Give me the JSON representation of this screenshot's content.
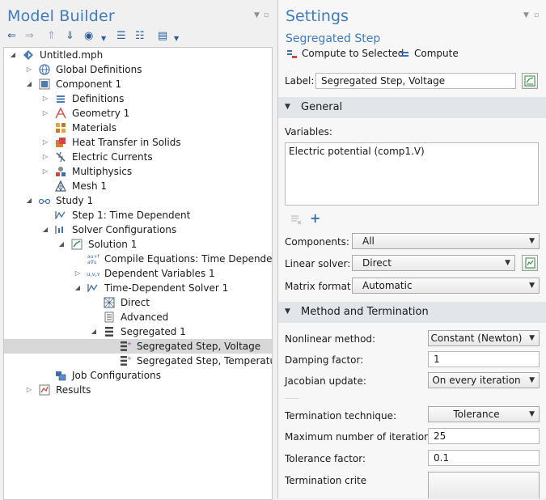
{
  "model_builder": {
    "title": "Model Builder",
    "tree": [
      {
        "label": "Untitled.mph"
      },
      {
        "label": "Global Definitions"
      },
      {
        "label": "Component 1"
      },
      {
        "label": "Definitions"
      },
      {
        "label": "Geometry 1"
      },
      {
        "label": "Materials"
      },
      {
        "label": "Heat Transfer in Solids"
      },
      {
        "label": "Electric Currents"
      },
      {
        "label": "Multiphysics"
      },
      {
        "label": "Mesh 1"
      },
      {
        "label": "Study 1"
      },
      {
        "label": "Step 1: Time Dependent"
      },
      {
        "label": "Solver Configurations"
      },
      {
        "label": "Solution 1"
      },
      {
        "label": "Compile Equations: Time Dependent"
      },
      {
        "label": "Dependent Variables 1"
      },
      {
        "label": "Time-Dependent Solver 1"
      },
      {
        "label": "Direct"
      },
      {
        "label": "Advanced"
      },
      {
        "label": "Segregated 1"
      },
      {
        "label": "Segregated Step, Voltage"
      },
      {
        "label": "Segregated Step, Temperature"
      },
      {
        "label": "Job Configurations"
      },
      {
        "label": "Results"
      }
    ]
  },
  "settings": {
    "title": "Settings",
    "subtitle": "Segregated Step",
    "compute_to_selected": "Compute to Selected",
    "compute": "Compute",
    "label_caption": "Label:",
    "label_value": "Segregated Step, Voltage",
    "general": {
      "title": "General",
      "variables_caption": "Variables:",
      "variables": [
        "Electric potential (comp1.V)"
      ],
      "components_caption": "Components:",
      "components_value": "All",
      "linear_solver_caption": "Linear solver:",
      "linear_solver_value": "Direct",
      "matrix_format_caption": "Matrix format:",
      "matrix_format_value": "Automatic"
    },
    "method": {
      "title": "Method and Termination",
      "nonlinear_caption": "Nonlinear method:",
      "nonlinear_value": "Constant (Newton)",
      "damping_caption": "Damping factor:",
      "damping_value": "1",
      "jacobian_caption": "Jacobian update:",
      "jacobian_value": "On every iteration",
      "termination_caption": "Termination technique:",
      "termination_value": "Tolerance",
      "maxiter_caption": "Maximum number of iterations:",
      "maxiter_value": "25",
      "tolfactor_caption": "Tolerance factor:",
      "tolfactor_value": "0.1",
      "termcrit_caption": "Termination crite"
    }
  }
}
